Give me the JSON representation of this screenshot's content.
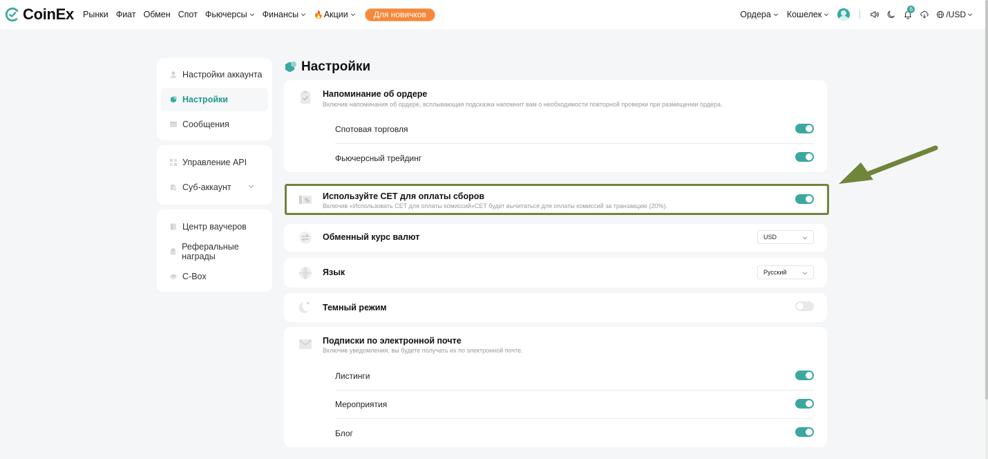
{
  "brand": {
    "name": "CoinEx",
    "accent": "#3aa8a0"
  },
  "nav": {
    "items": [
      {
        "label": "Рынки",
        "dropdown": false
      },
      {
        "label": "Фиат",
        "dropdown": false
      },
      {
        "label": "Обмен",
        "dropdown": false
      },
      {
        "label": "Спот",
        "dropdown": false
      },
      {
        "label": "Фьючерсы",
        "dropdown": true
      },
      {
        "label": "Финансы",
        "dropdown": true
      },
      {
        "label": "Акции",
        "dropdown": true,
        "icon": "fire-icon"
      }
    ],
    "promo_label": "Для новичков",
    "orders_label": "Ордера",
    "wallet_label": "Кошелек",
    "bell_count": "6",
    "currency_label": "/USD"
  },
  "sidebar": {
    "groups": [
      [
        {
          "label": "Настройки аккаунта",
          "icon": "user-icon",
          "active": false
        },
        {
          "label": "Настройки",
          "icon": "settings-icon",
          "active": true
        },
        {
          "label": "Сообщения",
          "icon": "message-icon",
          "active": false
        }
      ],
      [
        {
          "label": "Управление API",
          "icon": "api-icon",
          "active": false
        },
        {
          "label": "Суб-аккаунт",
          "icon": "sub-account-icon",
          "active": false,
          "dropdown": true
        }
      ],
      [
        {
          "label": "Центр ваучеров",
          "icon": "voucher-icon",
          "active": false
        },
        {
          "label": "Реферальные награды",
          "icon": "referral-icon",
          "active": false
        },
        {
          "label": "C-Box",
          "icon": "cbox-icon",
          "active": false
        }
      ]
    ]
  },
  "main": {
    "title": "Настройки",
    "order_reminder": {
      "title": "Напоминание об ордере",
      "desc": "Включив напоминания об ордере, всплывающая подсказка напомнит вам о необходимости повторной проверки при размещении ордера.",
      "options": [
        {
          "label": "Спотовая торговля",
          "on": true
        },
        {
          "label": "Фьючерсный трейдинг",
          "on": true
        }
      ]
    },
    "cet_fee": {
      "title": "Используйте CET для оплаты сборов",
      "desc": "Включив «Использовать CET для оплаты комиссий»CET будет вычитаться для оплаты комиссий за транзакцию (20%).",
      "on": true
    },
    "exchange_rate": {
      "title": "Обменный курс валют",
      "value": "USD"
    },
    "language": {
      "title": "Язык",
      "value": "Русский"
    },
    "dark_mode": {
      "title": "Темный режим",
      "on": false
    },
    "email_subs": {
      "title": "Подписки по электронной почте",
      "desc": "Включив уведомления, вы будете получать их по электронной почте.",
      "options": [
        {
          "label": "Листинги",
          "on": true
        },
        {
          "label": "Мероприятия",
          "on": true
        },
        {
          "label": "Блог",
          "on": true
        }
      ]
    }
  }
}
